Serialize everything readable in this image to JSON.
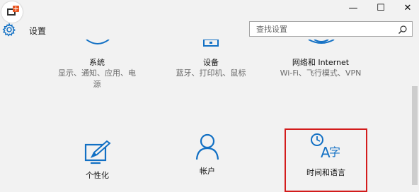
{
  "window": {
    "title": "设置",
    "minimize_glyph": "—",
    "maximize_glyph": "☐",
    "close_glyph": "✕"
  },
  "search": {
    "placeholder": "查找设置"
  },
  "tiles": [
    {
      "name": "系统",
      "desc_lines": [
        "显示、通知、应用、电",
        "源"
      ],
      "icon": "system-icon"
    },
    {
      "name": "设备",
      "desc_lines": [
        "蓝牙、打印机、鼠标"
      ],
      "icon": "devices-icon"
    },
    {
      "name": "网络和 Internet",
      "desc_lines": [
        "Wi-Fi、飞行模式、VPN"
      ],
      "icon": "network-icon"
    },
    {
      "name": "个性化",
      "desc_lines": [],
      "icon": "personalization-icon"
    },
    {
      "name": "帐户",
      "desc_lines": [],
      "icon": "accounts-icon"
    },
    {
      "name": "时间和语言",
      "desc_lines": [],
      "icon": "time-language-icon",
      "highlighted": true
    }
  ],
  "colors": {
    "accent": "#1270c4",
    "highlight_border": "#d31c1c",
    "background": "#f2f2f2"
  }
}
